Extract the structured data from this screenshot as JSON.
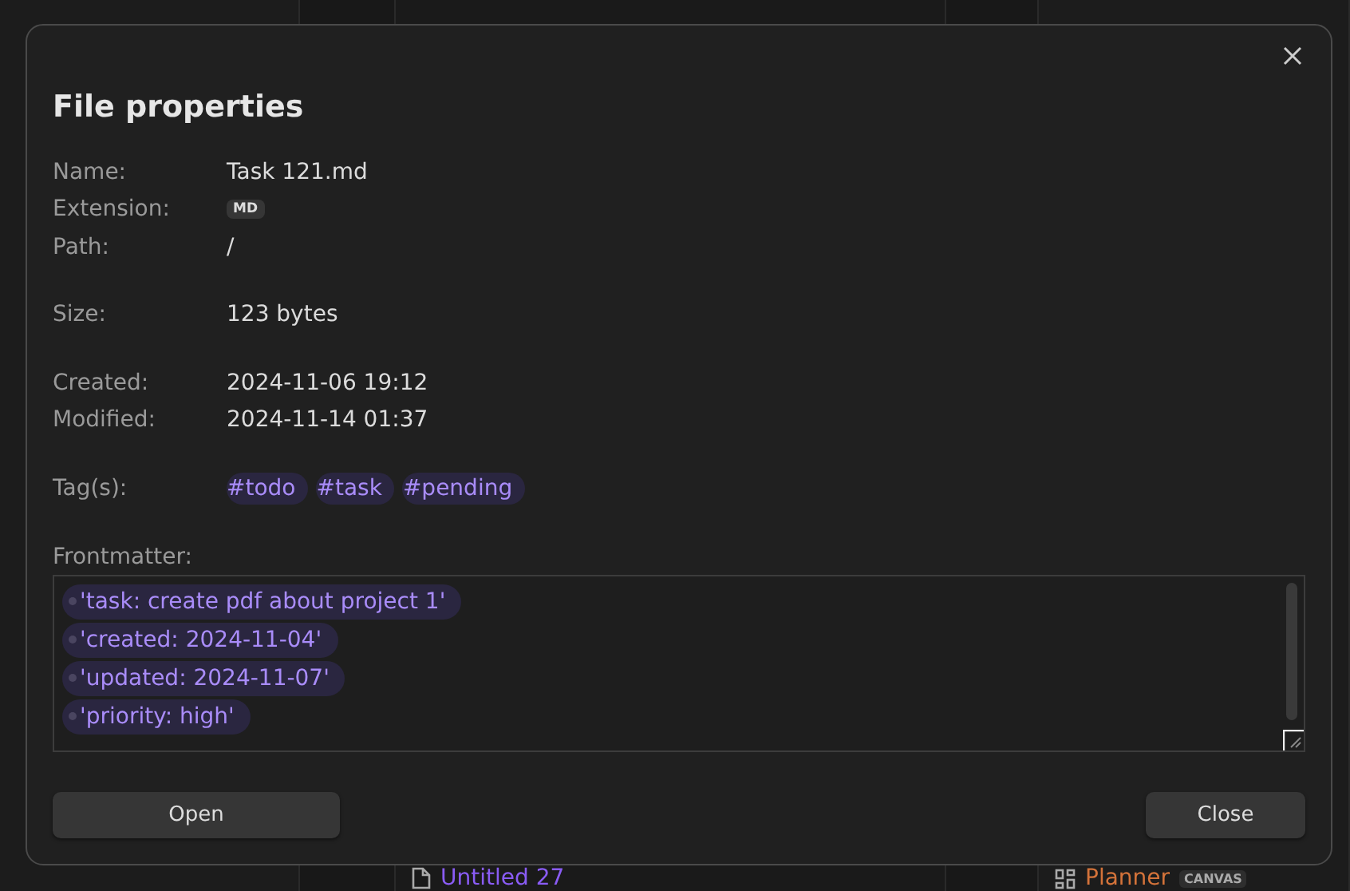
{
  "background_items": [
    {
      "kind": "file",
      "label": "Untitled 27"
    },
    {
      "kind": "canvas",
      "label": "Planner",
      "badge": "CANVAS"
    }
  ],
  "dialog": {
    "title": "File properties",
    "groups": [
      [
        {
          "kind": "text",
          "label": "Name:",
          "value": "Task 121.md"
        },
        {
          "kind": "badge",
          "label": "Extension:",
          "value": "MD"
        },
        {
          "kind": "text",
          "label": "Path:",
          "value": "/"
        }
      ],
      [
        {
          "kind": "text",
          "label": "Size:",
          "value": "123 bytes"
        }
      ],
      [
        {
          "kind": "text",
          "label": "Created:",
          "value": "2024-11-06 19:12"
        },
        {
          "kind": "text",
          "label": "Modified:",
          "value": "2024-11-14 01:37"
        }
      ],
      [
        {
          "kind": "tags",
          "label": "Tag(s):",
          "tags": [
            "#todo",
            "#task",
            "#pending"
          ]
        }
      ]
    ],
    "frontmatter": {
      "label": "Frontmatter:",
      "items": [
        "'task: create pdf about project 1'",
        "'created: 2024-11-04'",
        "'updated: 2024-11-07'",
        "'priority: high'"
      ]
    },
    "buttons": [
      {
        "kind": "open",
        "label": "Open"
      },
      {
        "kind": "close",
        "label": "Close"
      }
    ]
  }
}
